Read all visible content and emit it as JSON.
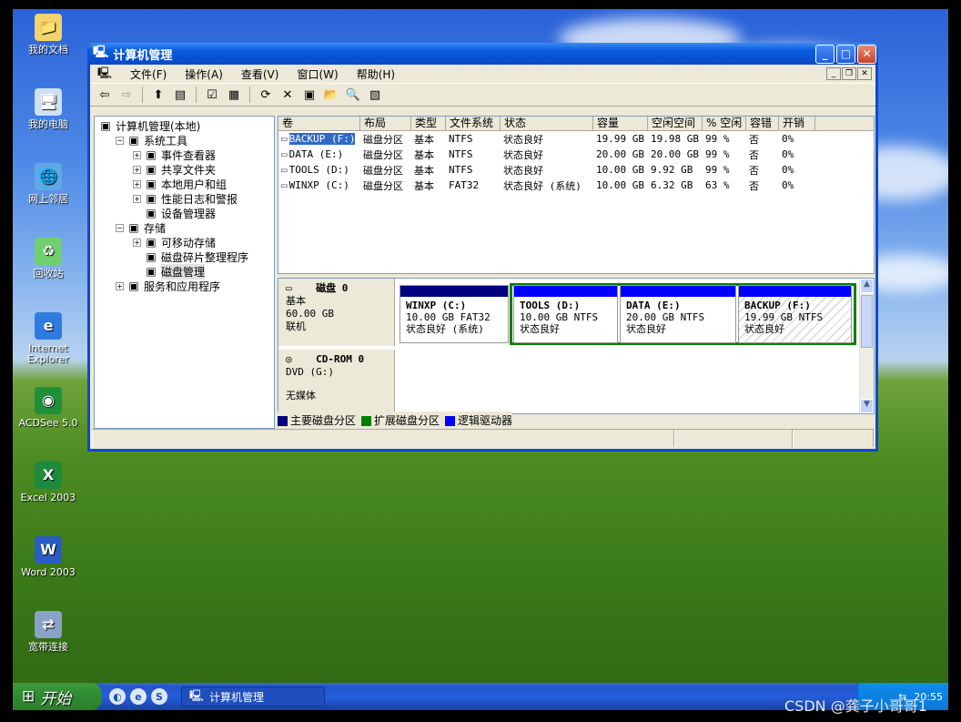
{
  "desktop": {
    "icons": [
      {
        "label": "我的文档",
        "icon": "my-documents-icon"
      },
      {
        "label": "我的电脑",
        "icon": "my-computer-icon"
      },
      {
        "label": "网上邻居",
        "icon": "network-places-icon"
      },
      {
        "label": "回收站",
        "icon": "recycle-bin-icon"
      },
      {
        "label": "Internet Explorer",
        "icon": "internet-explorer-icon"
      },
      {
        "label": "ACDSee 5.0",
        "icon": "acdsee-icon"
      },
      {
        "label": "Excel 2003",
        "icon": "excel-icon"
      },
      {
        "label": "Word 2003",
        "icon": "word-icon"
      },
      {
        "label": "宽带连接",
        "icon": "broadband-connection-icon"
      }
    ]
  },
  "window": {
    "title": "计算机管理",
    "menu": [
      "文件(F)",
      "操作(A)",
      "查看(V)",
      "窗口(W)",
      "帮助(H)"
    ],
    "tree": [
      {
        "label": "计算机管理(本地)",
        "level": 0,
        "icon": "computer-management-icon"
      },
      {
        "label": "系统工具",
        "level": 1,
        "exp": "−",
        "icon": "system-tools-icon"
      },
      {
        "label": "事件查看器",
        "level": 2,
        "exp": "+",
        "icon": "event-viewer-icon"
      },
      {
        "label": "共享文件夹",
        "level": 2,
        "exp": "+",
        "icon": "shared-folders-icon"
      },
      {
        "label": "本地用户和组",
        "level": 2,
        "exp": "+",
        "icon": "local-users-icon"
      },
      {
        "label": "性能日志和警报",
        "level": 2,
        "exp": "+",
        "icon": "performance-logs-icon"
      },
      {
        "label": "设备管理器",
        "level": 2,
        "exp": "",
        "icon": "device-manager-icon"
      },
      {
        "label": "存储",
        "level": 1,
        "exp": "−",
        "icon": "storage-icon"
      },
      {
        "label": "可移动存储",
        "level": 2,
        "exp": "+",
        "icon": "removable-storage-icon"
      },
      {
        "label": "磁盘碎片整理程序",
        "level": 2,
        "exp": "",
        "icon": "defragmenter-icon"
      },
      {
        "label": "磁盘管理",
        "level": 2,
        "exp": "",
        "icon": "disk-management-icon",
        "selected": true
      },
      {
        "label": "服务和应用程序",
        "level": 1,
        "exp": "+",
        "icon": "services-apps-icon"
      }
    ],
    "columns": [
      "卷",
      "布局",
      "类型",
      "文件系统",
      "状态",
      "容量",
      "空闲空间",
      "% 空闲",
      "容错",
      "开销"
    ],
    "volumes": [
      {
        "vol": "BACKUP (F:)",
        "layout": "磁盘分区",
        "type": "基本",
        "fs": "NTFS",
        "status": "状态良好",
        "cap": "19.99 GB",
        "free": "19.98 GB",
        "pct": "99 %",
        "ft": "否",
        "ovh": "0%",
        "selected": true
      },
      {
        "vol": "DATA (E:)",
        "layout": "磁盘分区",
        "type": "基本",
        "fs": "NTFS",
        "status": "状态良好",
        "cap": "20.00 GB",
        "free": "20.00 GB",
        "pct": "99 %",
        "ft": "否",
        "ovh": "0%"
      },
      {
        "vol": "TOOLS (D:)",
        "layout": "磁盘分区",
        "type": "基本",
        "fs": "NTFS",
        "status": "状态良好",
        "cap": "10.00 GB",
        "free": "9.92 GB",
        "pct": "99 %",
        "ft": "否",
        "ovh": "0%"
      },
      {
        "vol": "WINXP (C:)",
        "layout": "磁盘分区",
        "type": "基本",
        "fs": "FAT32",
        "status": "状态良好 (系统)",
        "cap": "10.00 GB",
        "free": "6.32 GB",
        "pct": "63 %",
        "ft": "否",
        "ovh": "0%"
      }
    ],
    "disk0": {
      "name": "磁盘 0",
      "kind": "基本",
      "size": "60.00 GB",
      "state": "联机"
    },
    "partitions": [
      {
        "name": "WINXP  (C:)",
        "info": "10.00 GB FAT32",
        "status": "状态良好 (系统)"
      },
      {
        "name": "TOOLS  (D:)",
        "info": "10.00 GB NTFS",
        "status": "状态良好"
      },
      {
        "name": "DATA  (E:)",
        "info": "20.00 GB NTFS",
        "status": "状态良好"
      },
      {
        "name": "BACKUP  (F:)",
        "info": "19.99 GB NTFS",
        "status": "状态良好"
      }
    ],
    "cdrom": {
      "name": "CD-ROM 0",
      "drive": "DVD (G:)",
      "media": "无媒体"
    },
    "legend": [
      {
        "label": "主要磁盘分区",
        "color": "#000080"
      },
      {
        "label": "扩展磁盘分区",
        "color": "#008000"
      },
      {
        "label": "逻辑驱动器",
        "color": "#0000ff"
      }
    ]
  },
  "taskbar": {
    "start": "开始",
    "task": "计算机管理",
    "clock": "20:55"
  },
  "watermark": "CSDN @龚子小哥哥1"
}
